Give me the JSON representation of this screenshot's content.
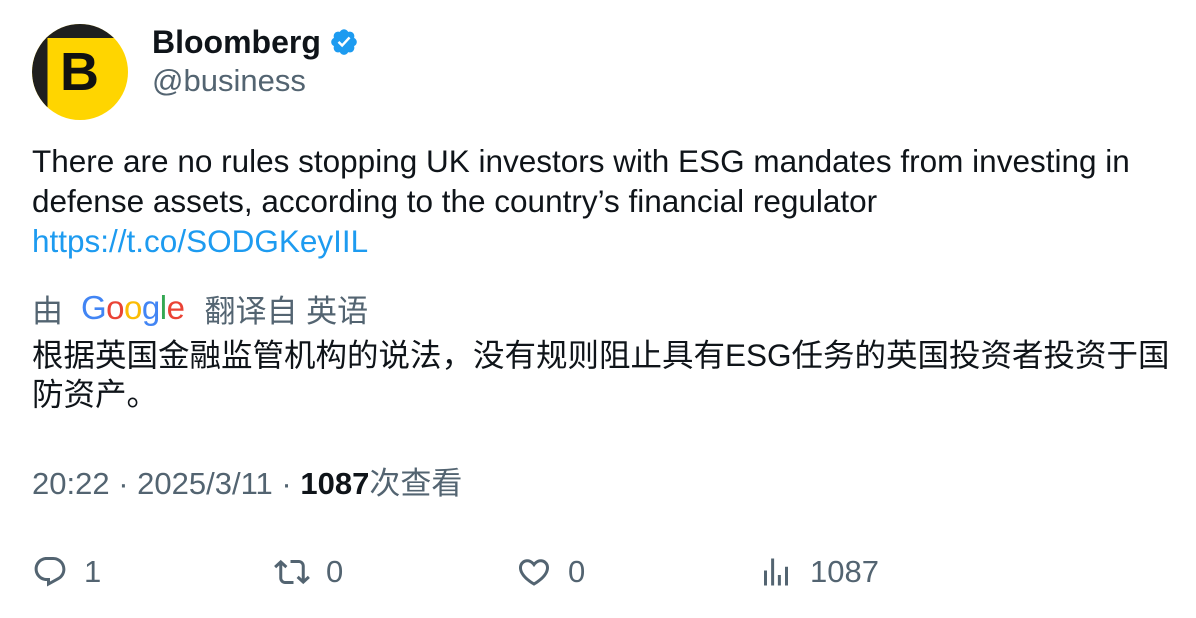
{
  "author": {
    "name": "Bloomberg",
    "handle": "@business",
    "avatar_letter": "B",
    "verified_icon": "verified-badge-icon",
    "verified_color": "#1d9bf0",
    "avatar_color": "#ffd500"
  },
  "tweet": {
    "text": "There are no rules stopping UK investors with ESG mandates from investing in defense assets, according to the country’s financial regulator",
    "link": "https://t.co/SODGKeyIIL"
  },
  "translation": {
    "prefix": "由",
    "provider_parts": [
      "G",
      "o",
      "o",
      "g",
      "l",
      "e"
    ],
    "suffix": "翻译自 英语",
    "text": "根据英国金融监管机构的说法，没有规则阻止具有ESG任务的英国投资者投资于国防资产。"
  },
  "meta": {
    "time": "20:22",
    "separator": "·",
    "date": "2025/3/11",
    "views_count": "1087",
    "views_label": "次查看"
  },
  "actions": {
    "replies": "1",
    "retweets": "0",
    "likes": "0",
    "views": "1087",
    "icons": [
      "reply-icon",
      "retweet-icon",
      "like-icon",
      "views-icon"
    ]
  }
}
